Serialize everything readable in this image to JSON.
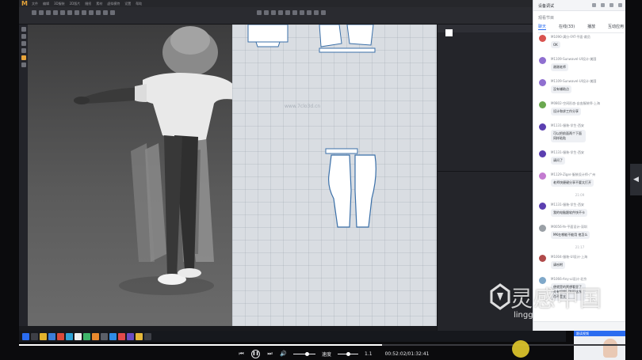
{
  "app": {
    "logo": "M",
    "menu": [
      "文件",
      "编辑",
      "3D服装",
      "2D版片",
      "缝纫",
      "素材",
      "虚拟模特",
      "设置",
      "帮助"
    ],
    "viewport_2d_watermark": "www.7clo3d.cn"
  },
  "chat": {
    "title": "设备调试",
    "subtitle": "观看节目",
    "tabs": [
      "聊天",
      "在线(33)",
      "播放",
      "互动应用"
    ],
    "messages": [
      {
        "name": "M1090-满分-FAT-平面-裁员",
        "text": "OK",
        "avatar": "#d9534f"
      },
      {
        "name": "M1109-Sunwavel-UI设计-美国",
        "text": "谢谢老师",
        "avatar": "#8f6fd0"
      },
      {
        "name": "M1109-Sunwavel-UI设计-美国",
        "text": "没有辅助点",
        "avatar": "#8f6fd0"
      },
      {
        "name": "M0802-空间形态-自由服装师-上海",
        "text": "设计和求工作分享",
        "avatar": "#6aa84f"
      },
      {
        "name": "M1131-服装-学生-西安",
        "text": "可以把前面两个下面同样粘贴",
        "avatar": "#5b3fb0",
        "tall": true
      },
      {
        "name": "M1131-服装-学生-西安",
        "text": "请问了",
        "avatar": "#5b3fb0"
      },
      {
        "name": "M1129-Ziger-服装设计师-广州",
        "text": "老师快捷键分享不要太打开",
        "avatar": "#c37bd0"
      }
    ],
    "time1": "21:09",
    "messages2": [
      {
        "name": "M1131-服装-学生-西安",
        "text": "我的电脑跟软件快不卡",
        "avatar": "#5b3fb0"
      },
      {
        "name": "M0056-Ye-平面设计-深圳",
        "text": "MK在哪能不能用 他怎么",
        "avatar": "#9aa0a6"
      }
    ],
    "time2": "21:17",
    "messages3": [
      {
        "name": "M1004-服装-UI设计-上海",
        "text": "请吩咐",
        "avatar": "#b04a4a"
      },
      {
        "name": "M1066-Any-ui设计-北京",
        "text": "便就是的要想看里了 先有如效的发现这东西不是支",
        "avatar": "#7fa8c9",
        "tall": true
      }
    ],
    "pip_label": "跟读视频"
  },
  "player": {
    "progress": 0.599,
    "speed_label": "速度",
    "speed_value": "1.1",
    "time": "00:52:02/01:32:41",
    "volume": 0.6
  },
  "watermark": {
    "text_cn": "灵感中国",
    "url": "lingganchina.com"
  }
}
